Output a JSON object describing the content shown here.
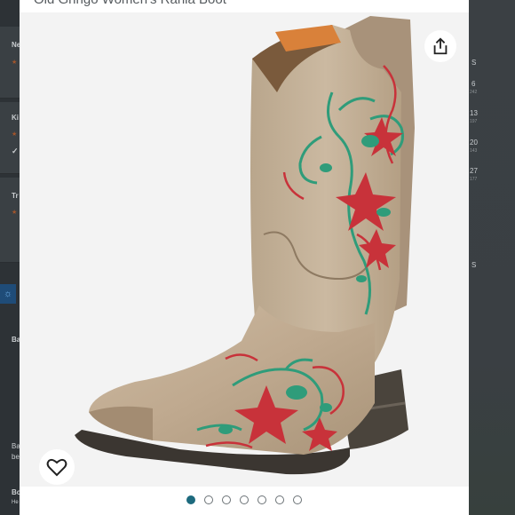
{
  "listing": {
    "title": "Old Gringo Women's Rania Boot",
    "image_alt": "Tan leather cowboy boot with red and green floral embroidery"
  },
  "carousel": {
    "total": 7,
    "active_index": 0
  },
  "actions": {
    "share_icon": "share-icon",
    "like_icon": "heart-icon"
  },
  "background": {
    "left_labels": [
      "Ne",
      "Ki",
      "Tr",
      "Ba",
      "Ba",
      "be",
      "Bo",
      "He"
    ],
    "right_calendar": [
      {
        "num": "S",
        "sub": ""
      },
      {
        "num": "6",
        "sub": "242"
      },
      {
        "num": "13",
        "sub": "197"
      },
      {
        "num": "20",
        "sub": "143"
      },
      {
        "num": "27",
        "sub": "177"
      },
      {
        "num": "S",
        "sub": ""
      }
    ]
  },
  "colors": {
    "accent": "#1d6a7e",
    "leather": "#c7b49b",
    "embroidery_red": "#c8323a",
    "embroidery_green": "#2f9c7a"
  }
}
